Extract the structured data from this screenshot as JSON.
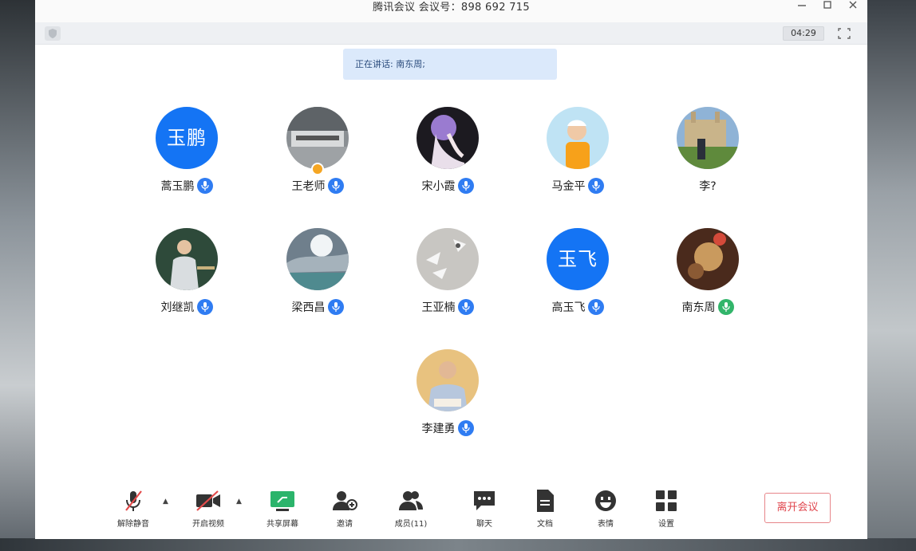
{
  "window": {
    "title": "腾讯会议 会议号：898 692 715",
    "controls": [
      "minimize-icon",
      "maximize-icon",
      "close-icon"
    ]
  },
  "toolbar": {
    "timer": "04:29"
  },
  "speaking": {
    "text": "正在讲话: 南东周;"
  },
  "participants": [
    {
      "name": "蒿玉鹏",
      "avatar_text": "玉鹏",
      "mic": "blue"
    },
    {
      "name": "王老师",
      "avatar_text": "",
      "mic": "blue",
      "host": true
    },
    {
      "name": "宋小霞",
      "avatar_text": "",
      "mic": "blue"
    },
    {
      "name": "马金平",
      "avatar_text": "",
      "mic": "blue"
    },
    {
      "name": "李?",
      "avatar_text": "",
      "mic": "none"
    },
    {
      "name": "刘继凯",
      "avatar_text": "",
      "mic": "blue"
    },
    {
      "name": "梁西昌",
      "avatar_text": "",
      "mic": "blue"
    },
    {
      "name": "王亚楠",
      "avatar_text": "",
      "mic": "blue"
    },
    {
      "name": "高玉飞",
      "avatar_text": "玉飞",
      "mic": "blue"
    },
    {
      "name": "南东周",
      "avatar_text": "",
      "mic": "green"
    },
    {
      "name": "李建勇",
      "avatar_text": "",
      "mic": "blue"
    }
  ],
  "bottom": {
    "unmute": "解除静音",
    "start_video": "开启视频",
    "share_screen": "共享屏幕",
    "invite": "邀请",
    "members": "成员(11)",
    "chat": "聊天",
    "docs": "文档",
    "reactions": "表情",
    "settings": "设置",
    "leave": "离开会议"
  },
  "colors": {
    "accent": "#1474f4",
    "speaking_bg": "#dbe9fb",
    "leave": "#e0464d",
    "active_mic": "#32b56a"
  }
}
